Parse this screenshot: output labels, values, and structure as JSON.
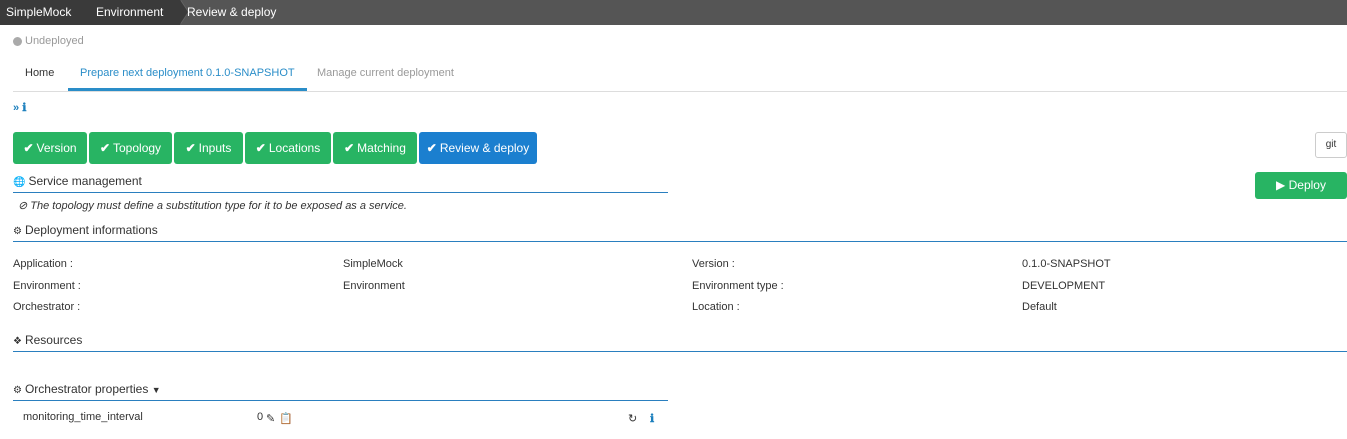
{
  "breadcrumb": {
    "app": "SimpleMock",
    "environment": "Environment",
    "page": "Review & deploy"
  },
  "status": {
    "label": "Undeployed",
    "color": "#aaaaaa"
  },
  "tabs": [
    {
      "label": "Home"
    },
    {
      "label": "Prepare next deployment 0.1.0-SNAPSHOT",
      "active": true
    },
    {
      "label": "Manage current deployment"
    }
  ],
  "expander": {
    "icons": [
      "double-chevron-down-icon",
      "info-icon"
    ]
  },
  "steps": [
    {
      "label": "Version",
      "icon": "check-icon"
    },
    {
      "label": "Topology",
      "icon": "check-icon"
    },
    {
      "label": "Inputs",
      "icon": "check-icon"
    },
    {
      "label": "Locations",
      "icon": "check-icon"
    },
    {
      "label": "Matching",
      "icon": "check-icon"
    },
    {
      "label": "Review & deploy",
      "icon": "check-icon",
      "active": true
    }
  ],
  "actions": {
    "git_label": "git",
    "deploy_label": "Deploy"
  },
  "service_management": {
    "title": "Service management",
    "notice": "The topology must define a substitution type for it to be exposed as a service."
  },
  "deployment_info": {
    "title": "Deployment informations",
    "left": [
      {
        "label": "Application :",
        "value": "SimpleMock"
      },
      {
        "label": "Environment :",
        "value": "Environment"
      },
      {
        "label": "Orchestrator :",
        "value": ""
      }
    ],
    "right": [
      {
        "label": "Version :",
        "value": "0.1.0-SNAPSHOT"
      },
      {
        "label": "Environment type :",
        "value": "DEVELOPMENT"
      },
      {
        "label": "Location :",
        "value": "Default"
      }
    ]
  },
  "resources": {
    "title": "Resources"
  },
  "orchestrator_properties": {
    "title": "Orchestrator properties",
    "rows": [
      {
        "name": "monitoring_time_interval",
        "value": "0"
      }
    ]
  },
  "colors": {
    "green": "#28b463",
    "blue": "#1b7fcf",
    "link": "#2a8dc8",
    "topbar": "#555555"
  }
}
